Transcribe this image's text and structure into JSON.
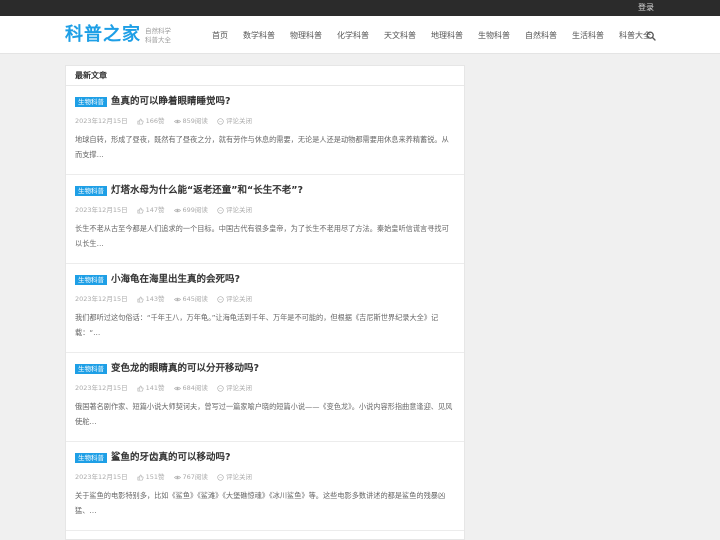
{
  "topbar": {
    "login_label": "登录"
  },
  "header": {
    "logo": "科普之家",
    "tagline_line1": "自然科学",
    "tagline_line2": "科普大全",
    "nav": [
      "首页",
      "数学科普",
      "物理科普",
      "化学科普",
      "天文科普",
      "地理科普",
      "生物科普",
      "自然科普",
      "生活科普",
      "科普大全"
    ]
  },
  "section": {
    "title": "最新文章"
  },
  "articles": [
    {
      "category": "生物科普",
      "title": "鱼真的可以睁着眼睛睡觉吗?",
      "date": "2023年12月15日",
      "likes": "166赞",
      "reads": "859阅读",
      "comments": "评论关闭",
      "excerpt": "地球自转，形成了昼夜，既然有了昼夜之分，就有劳作与休息的需要，无论是人还是动物都需要用休息来养精蓄锐。从而支撑…"
    },
    {
      "category": "生物科普",
      "title": "灯塔水母为什么能“返老还童”和“长生不老”?",
      "date": "2023年12月15日",
      "likes": "147赞",
      "reads": "699阅读",
      "comments": "评论关闭",
      "excerpt": "长生不老从古至今都是人们追求的一个目标。中国古代有很多皇帝，为了长生不老用尽了方法。秦始皇听信谎言寻找可以长生…"
    },
    {
      "category": "生物科普",
      "title": "小海龟在海里出生真的会死吗?",
      "date": "2023年12月15日",
      "likes": "143赞",
      "reads": "645阅读",
      "comments": "评论关闭",
      "excerpt": "我们都听过这句俗话：“千年王八，万年龟。”让海龟活到千年、万年是不可能的，但根据《吉尼斯世界纪录大全》记载：“…"
    },
    {
      "category": "生物科普",
      "title": "变色龙的眼睛真的可以分开移动吗?",
      "date": "2023年12月15日",
      "likes": "141赞",
      "reads": "684阅读",
      "comments": "评论关闭",
      "excerpt": "俄国著名剧作家、短篇小说大师契诃夫，曾写过一篇家喻户晓的短篇小说——《变色龙》。小说内容形指曲意逢迎、见风使舵…"
    },
    {
      "category": "生物科普",
      "title": "鲨鱼的牙齿真的可以移动吗?",
      "date": "2023年12月15日",
      "likes": "151赞",
      "reads": "767阅读",
      "comments": "评论关闭",
      "excerpt": "关于鲨鱼的电影特别多，比如《鲨鱼》《鲨滩》《大堡礁惊魂》《冰川鲨鱼》等。这些电影多数讲述的都是鲨鱼的残暴凶猛、…"
    }
  ],
  "colors": {
    "accent": "#1e9fe6",
    "topbar": "#2b2b2b",
    "background": "#f0f0f0"
  },
  "icons": {
    "search": "search-icon",
    "like": "thumbs-up-icon",
    "read": "eye-icon",
    "comment": "comment-icon"
  }
}
